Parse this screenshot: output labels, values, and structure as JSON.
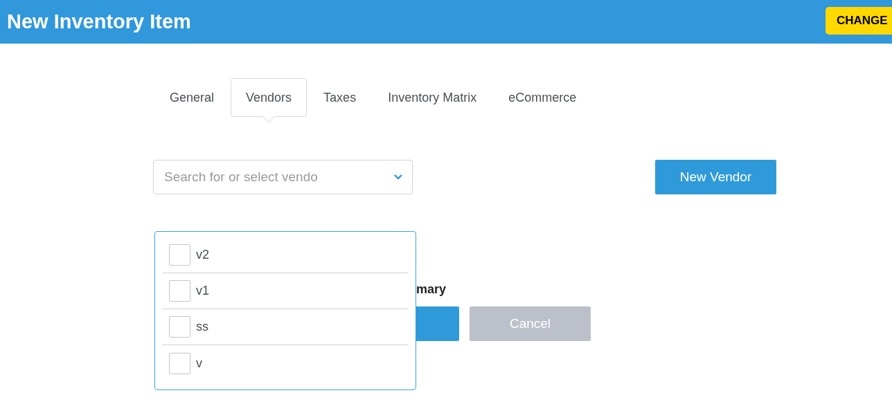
{
  "header": {
    "title": "New Inventory Item",
    "button": "CHANGE"
  },
  "tabs": [
    {
      "label": "General",
      "selected": false
    },
    {
      "label": "Vendors",
      "selected": true
    },
    {
      "label": "Taxes",
      "selected": false
    },
    {
      "label": "Inventory Matrix",
      "selected": false
    },
    {
      "label": "eCommerce",
      "selected": false
    }
  ],
  "vendor_search": {
    "placeholder": "Search for or select vendo"
  },
  "new_vendor_button": "New Vendor",
  "vendor_dropdown": {
    "options": [
      {
        "label": "v2",
        "checked": false
      },
      {
        "label": "v1",
        "checked": false
      },
      {
        "label": "ss",
        "checked": false
      },
      {
        "label": "v",
        "checked": false
      }
    ]
  },
  "partly_hidden_label": "mary",
  "buttons": [
    {
      "kind": "primary"
    },
    {
      "kind": "secondary",
      "label": "Cancel"
    }
  ]
}
